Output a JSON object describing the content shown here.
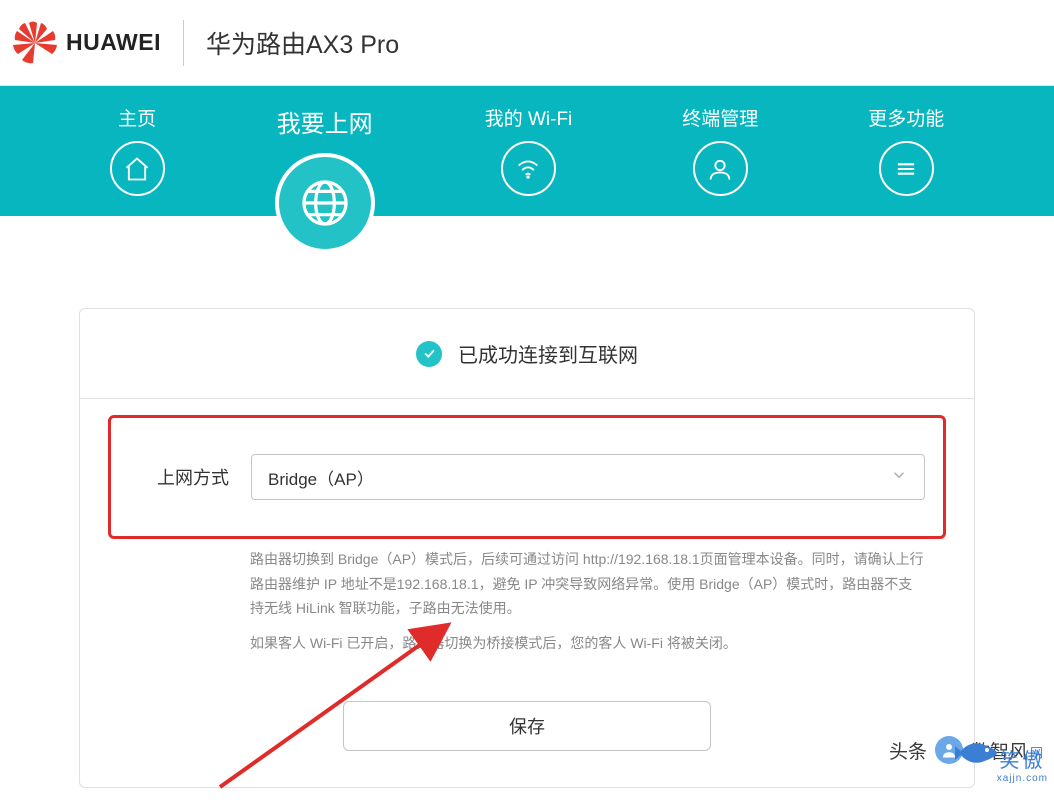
{
  "header": {
    "brand": "HUAWEI",
    "device": "华为路由AX3 Pro"
  },
  "nav": {
    "items": [
      {
        "label": "主页",
        "icon": "home"
      },
      {
        "label": "我要上网",
        "icon": "globe",
        "active": true
      },
      {
        "label": "我的 Wi-Fi",
        "icon": "wifi"
      },
      {
        "label": "终端管理",
        "icon": "user"
      },
      {
        "label": "更多功能",
        "icon": "menu"
      }
    ]
  },
  "status_text": "已成功连接到互联网",
  "form": {
    "mode_label": "上网方式",
    "mode_value": "Bridge（AP）",
    "help1": "路由器切换到 Bridge（AP）模式后，后续可通过访问 http://192.168.18.1页面管理本设备。同时，请确认上行路由器维护 IP 地址不是192.168.18.1，避免 IP 冲突导致网络异常。使用 Bridge（AP）模式时，路由器不支持无线 HiLink 智联功能，子路由无法使用。",
    "help2": "如果客人 Wi-Fi 已开启，路由器切换为桥接模式后，您的客人 Wi-Fi 将被关闭。",
    "save_label": "保存"
  },
  "watermarks": {
    "w1_prefix": "头条",
    "w1_name": "数智风",
    "w2_main": "笑傲",
    "w2_sub": "xajjn.com",
    "w2_side": "网"
  },
  "colors": {
    "primary": "#07b6bf",
    "accent": "#23c2c7",
    "highlight": "#e02b2b"
  }
}
